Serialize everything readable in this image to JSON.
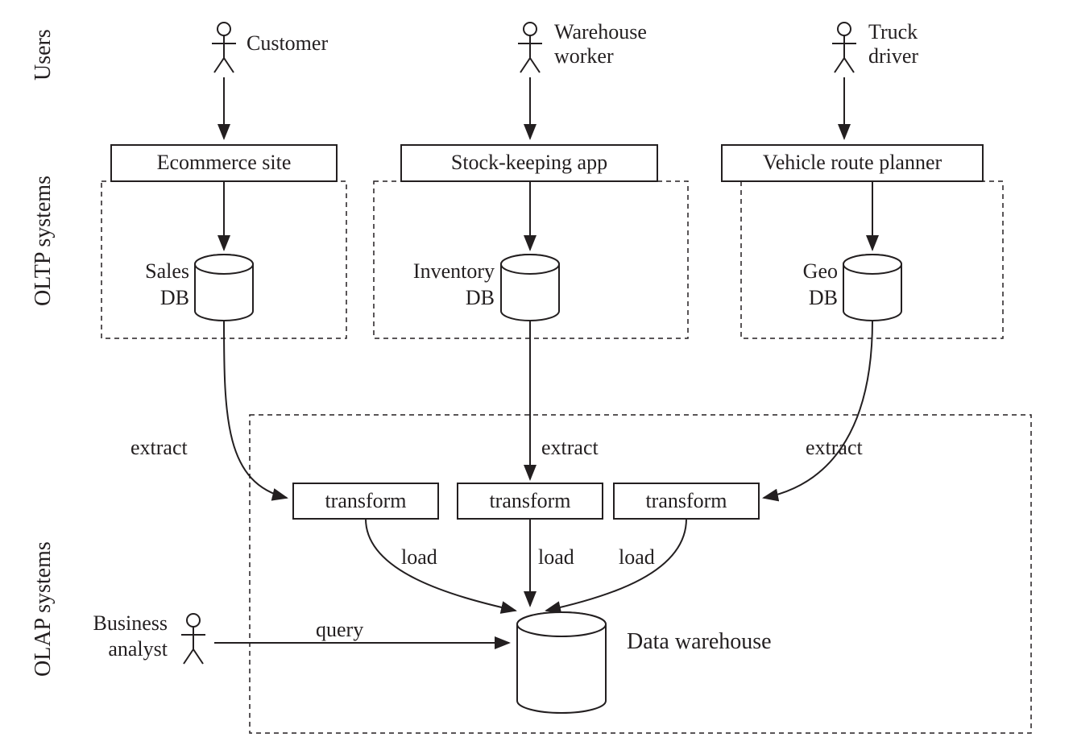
{
  "sections": {
    "users": "Users",
    "oltp": "OLTP systems",
    "olap": "OLAP systems"
  },
  "users": {
    "customer": "Customer",
    "warehouse_worker_line1": "Warehouse",
    "warehouse_worker_line2": "worker",
    "truck_driver_line1": "Truck",
    "truck_driver_line2": "driver",
    "business_analyst_line1": "Business",
    "business_analyst_line2": "analyst"
  },
  "apps": {
    "ecommerce": "Ecommerce site",
    "stock_keeping": "Stock-keeping app",
    "route_planner": "Vehicle route planner"
  },
  "databases": {
    "sales_line1": "Sales",
    "sales_line2": "DB",
    "inventory_line1": "Inventory",
    "inventory_line2": "DB",
    "geo_line1": "Geo",
    "geo_line2": "DB",
    "warehouse": "Data warehouse"
  },
  "flow": {
    "extract": "extract",
    "transform": "transform",
    "load": "load",
    "query": "query"
  }
}
